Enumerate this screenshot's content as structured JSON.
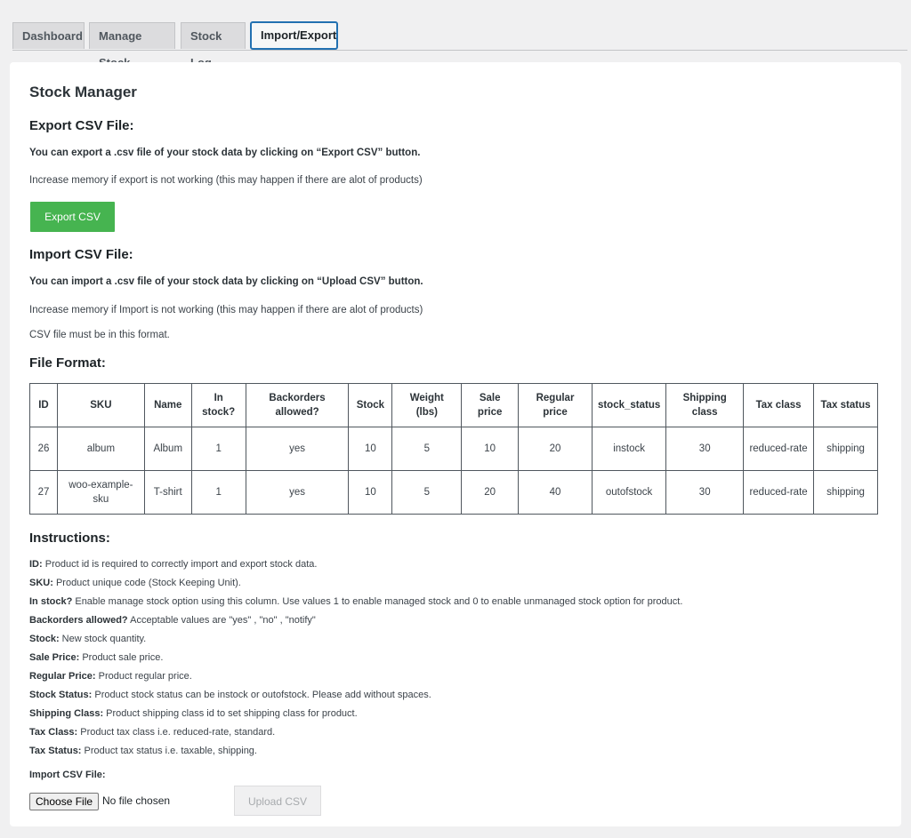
{
  "tabs": [
    {
      "label": "Dashboard"
    },
    {
      "label": "Manage Stock"
    },
    {
      "label": "Stock Log"
    },
    {
      "label": "Import/Export"
    }
  ],
  "page_title": "Stock Manager",
  "export": {
    "heading": "Export CSV File:",
    "description": "You can export a .csv file of your stock data by clicking on “Export CSV” button.",
    "memory_note": "Increase memory if export is not working (this may happen if there are alot of products)",
    "button_label": "Export CSV",
    "button_color": "#46b450"
  },
  "import": {
    "heading": "Import CSV File:",
    "description": "You can import a .csv file of your stock data by clicking on “Upload CSV” button.",
    "memory_note": "Increase memory if Import is not working (this may happen if there are alot of products)",
    "format_note": "CSV file must be in this format."
  },
  "file_format": {
    "heading": "File Format:",
    "headers": [
      "ID",
      "SKU",
      "Name",
      "In stock?",
      "Backorders allowed?",
      "Stock",
      "Weight (lbs)",
      "Sale price",
      "Regular price",
      "stock_status",
      "Shipping class",
      "Tax class",
      "Tax status"
    ],
    "rows": [
      [
        "26",
        "album",
        "Album",
        "1",
        "yes",
        "10",
        "5",
        "10",
        "20",
        "instock",
        "30",
        "reduced-rate",
        "shipping"
      ],
      [
        "27",
        "woo-example-sku",
        "T-shirt",
        "1",
        "yes",
        "10",
        "5",
        "20",
        "40",
        "outofstock",
        "30",
        "reduced-rate",
        "shipping"
      ]
    ]
  },
  "instructions": {
    "heading": "Instructions:",
    "items": [
      {
        "term": "ID:",
        "text": " Product id is required to correctly import and export stock data."
      },
      {
        "term": "SKU:",
        "text": " Product unique code (Stock Keeping Unit)."
      },
      {
        "term": "In stock?",
        "text": " Enable manage stock option using this column. Use values 1 to enable managed stock and 0 to enable unmanaged stock option for product."
      },
      {
        "term": "Backorders allowed?",
        "text": " Acceptable values are \"yes\" , \"no\" , \"notify\""
      },
      {
        "term": "Stock:",
        "text": " New stock quantity."
      },
      {
        "term": "Sale Price:",
        "text": " Product sale price."
      },
      {
        "term": "Regular Price:",
        "text": " Product regular price."
      },
      {
        "term": "Stock Status:",
        "text": " Product stock status can be instock or outofstock. Please add without spaces."
      },
      {
        "term": "Shipping Class:",
        "text": " Product shipping class id to set shipping class for product."
      },
      {
        "term": "Tax Class:",
        "text": " Product tax class i.e. reduced-rate, standard."
      },
      {
        "term": "Tax Status:",
        "text": " Product tax status i.e. taxable, shipping."
      }
    ]
  },
  "upload": {
    "label": "Import CSV File:",
    "choose_file_label": "Choose File",
    "no_file_text": "No file chosen",
    "upload_button_label": "Upload CSV"
  }
}
